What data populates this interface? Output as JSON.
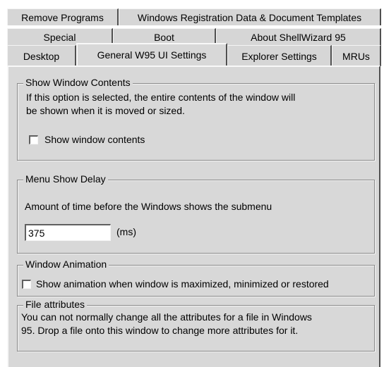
{
  "tabs": {
    "row1": [
      "Remove Programs",
      "Windows Registration Data & Document Templates"
    ],
    "row2": [
      "Special",
      "Boot",
      "About ShellWizard 95"
    ],
    "row3": [
      "Desktop",
      "General W95 UI Settings",
      "Explorer Settings",
      "MRUs"
    ]
  },
  "show_window_contents": {
    "legend": "Show Window Contents",
    "description_line1": "If this option is selected, the entire contents of the window will",
    "description_line2": "be shown when it is moved or sized.",
    "checkbox_label": "Show window contents",
    "checked": false
  },
  "menu_show_delay": {
    "legend": "Menu Show Delay",
    "description": "Amount of time before the Windows shows the submenu",
    "value": "375",
    "unit": "(ms)"
  },
  "window_animation": {
    "legend": "Window Animation",
    "checkbox_label": "Show animation when window is maximized, minimized or restored",
    "checked": false
  },
  "file_attributes": {
    "legend": "File attributes",
    "line1": "You can not normally change all the attributes for a file in Windows",
    "line2": "95. Drop a file onto this window to change more attributes for it."
  }
}
